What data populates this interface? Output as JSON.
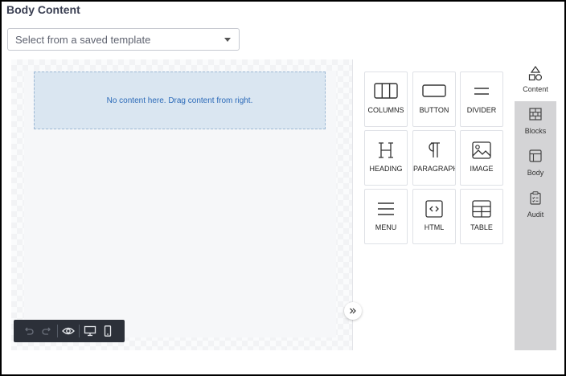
{
  "section": {
    "title": "Body Content"
  },
  "template_select": {
    "placeholder": "Select from a saved template"
  },
  "canvas": {
    "empty_message": "No content here. Drag content from right."
  },
  "content_tiles": [
    {
      "label": "COLUMNS",
      "icon": "columns-icon"
    },
    {
      "label": "BUTTON",
      "icon": "button-icon"
    },
    {
      "label": "DIVIDER",
      "icon": "divider-icon"
    },
    {
      "label": "HEADING",
      "icon": "heading-icon"
    },
    {
      "label": "PARAGRAPH",
      "icon": "paragraph-icon"
    },
    {
      "label": "IMAGE",
      "icon": "image-icon"
    },
    {
      "label": "MENU",
      "icon": "menu-icon"
    },
    {
      "label": "HTML",
      "icon": "html-icon"
    },
    {
      "label": "TABLE",
      "icon": "table-icon"
    }
  ],
  "side_tabs": [
    {
      "label": "Content",
      "icon": "shapes-icon",
      "active": true
    },
    {
      "label": "Blocks",
      "icon": "blocks-icon",
      "active": false
    },
    {
      "label": "Body",
      "icon": "body-layout-icon",
      "active": false
    },
    {
      "label": "Audit",
      "icon": "audit-clipboard-icon",
      "active": false
    }
  ],
  "toolbar": {
    "buttons": [
      "undo-icon",
      "redo-icon",
      "preview-eye-icon",
      "desktop-icon",
      "mobile-icon"
    ]
  },
  "colors": {
    "dropzone_bg": "#dae6f1",
    "dropzone_text": "#2a69b8",
    "toolbar_bg": "#2c3039",
    "tabs_bg": "#d4d4d6"
  }
}
